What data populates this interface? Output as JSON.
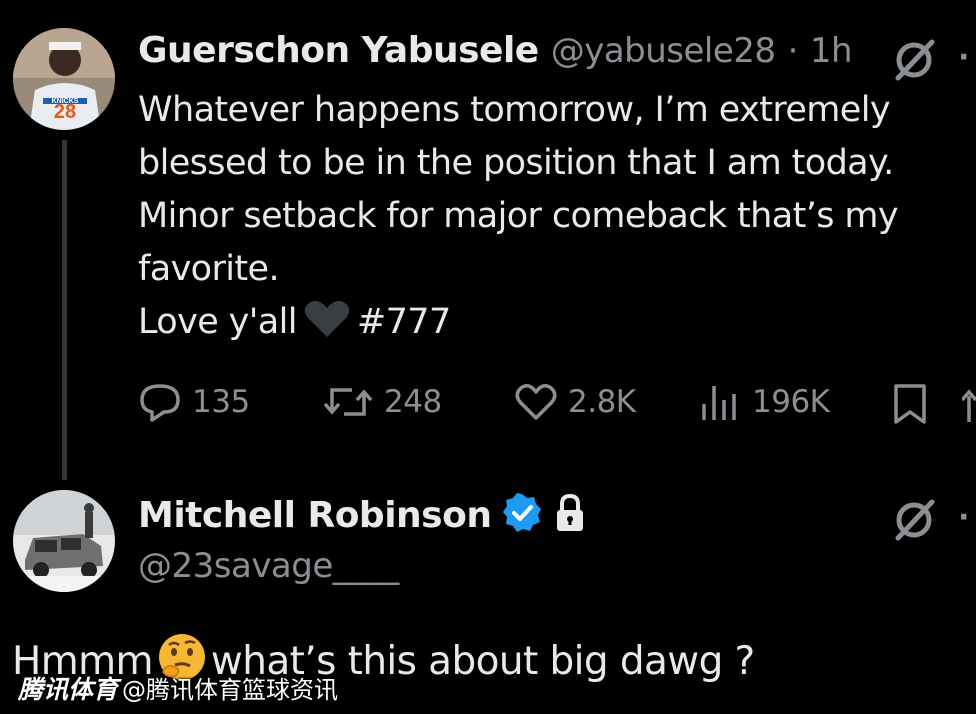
{
  "tweet1": {
    "display_name": "Guerschon Yabusele",
    "handle": "@yabusele28",
    "separator": "·",
    "time": "1h",
    "text_lines": [
      "Whatever happens tomorrow, I’m extremely",
      "blessed to be in the position that I am today.",
      "Minor setback for major comeback that’s my",
      "favorite."
    ],
    "love_prefix": "Love y'all",
    "love_suffix": "#777",
    "avatar_jersey_number": "28",
    "avatar_jersey_wordmark": "KNICKS",
    "actions": {
      "replies": "135",
      "reposts": "248",
      "likes": "2.8K",
      "views": "196K"
    }
  },
  "tweet2": {
    "display_name": "Mitchell Robinson",
    "handle": "@23savage____",
    "reply_prefix": "Hmmm",
    "reply_suffix": "what’s this about big dawg ?"
  },
  "watermark": {
    "logo_text": "腾讯体育",
    "account_text": "@腾讯体育篮球资讯"
  },
  "colors": {
    "background": "#000000",
    "text_primary": "#e7e9ea",
    "text_secondary": "#8b8f94",
    "verified_blue": "#1d9bf0",
    "heart_dark": "#3a3d42"
  }
}
